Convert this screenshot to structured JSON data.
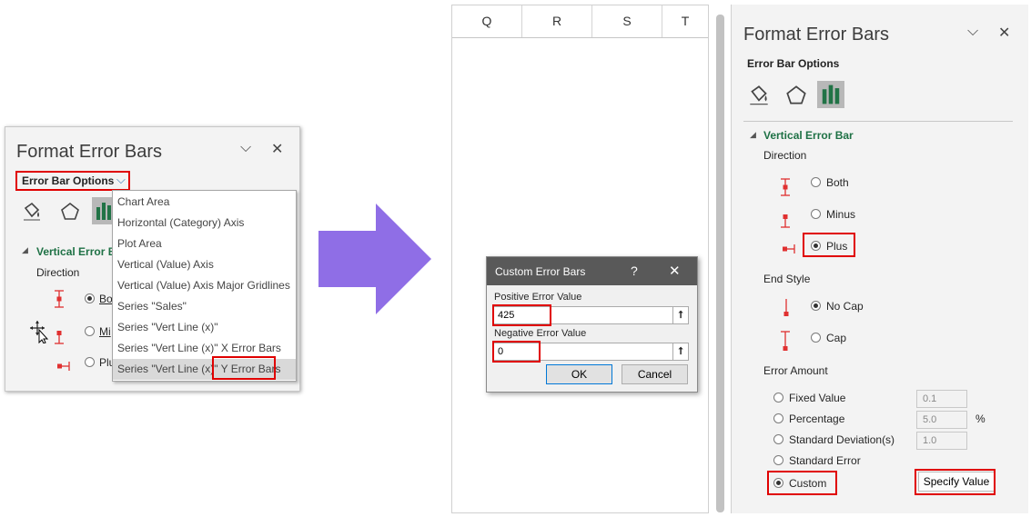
{
  "left_panel": {
    "title": "Format Error Bars",
    "options_dropdown": "Error Bar Options",
    "section": "Vertical Error B",
    "direction_label": "Direction",
    "radio_both": "Bo",
    "radio_minus": "Mi",
    "radio_plus": "Plu",
    "menu_items": [
      "Chart Area",
      "Horizontal (Category) Axis",
      "Plot Area",
      "Vertical (Value) Axis",
      "Vertical (Value) Axis Major Gridlines",
      "Series \"Sales\"",
      "Series \"Vert Line (x)\"",
      "Series \"Vert Line (x)\" X Error Bars",
      "Series \"Vert Line (x)\" Y Error Bars"
    ],
    "menu_selected_index": 8
  },
  "arrow": {
    "color": "#8f6ee6"
  },
  "sheet": {
    "columns": [
      "Q",
      "R",
      "S",
      "T"
    ]
  },
  "dialog": {
    "title": "Custom Error Bars",
    "help": "?",
    "positive_label": "Positive Error Value",
    "positive_value": "425",
    "negative_label": "Negative Error Value",
    "negative_value": "0",
    "ok": "OK",
    "cancel": "Cancel"
  },
  "right_panel": {
    "title": "Format Error Bars",
    "options_label": "Error Bar Options",
    "section": "Vertical Error Bar",
    "direction_label": "Direction",
    "direction": {
      "both": "Both",
      "minus": "Minus",
      "plus": "Plus",
      "selected": "plus"
    },
    "end_style_label": "End Style",
    "end_style": {
      "no_cap": "No Cap",
      "cap": "Cap",
      "selected": "no_cap"
    },
    "error_amount_label": "Error Amount",
    "amount": {
      "fixed": "Fixed Value",
      "fixed_val": "0.1",
      "percentage": "Percentage",
      "percentage_val": "5.0",
      "percent_sign": "%",
      "stddev": "Standard Deviation(s)",
      "stddev_val": "1.0",
      "stderr": "Standard Error",
      "custom": "Custom",
      "selected": "custom",
      "specify": "Specify Value"
    }
  },
  "colors": {
    "highlight": "#e00000",
    "section_green": "#1e7145",
    "chart_icon": "#217346"
  }
}
